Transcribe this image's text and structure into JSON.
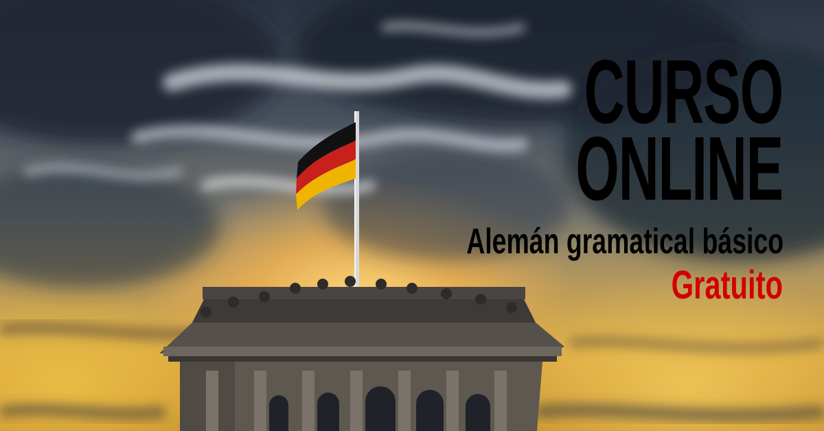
{
  "banner": {
    "line1": "CURSO",
    "line2": "ONLINE",
    "line3": "Alemán gramatical básico",
    "line4": "Gratuito"
  },
  "colors": {
    "headline": "#000000",
    "accent": "#d10000",
    "flag_black": "#111111",
    "flag_red": "#c8201c",
    "flag_gold": "#f0b400"
  },
  "icons": [
    "german-flag-icon"
  ]
}
